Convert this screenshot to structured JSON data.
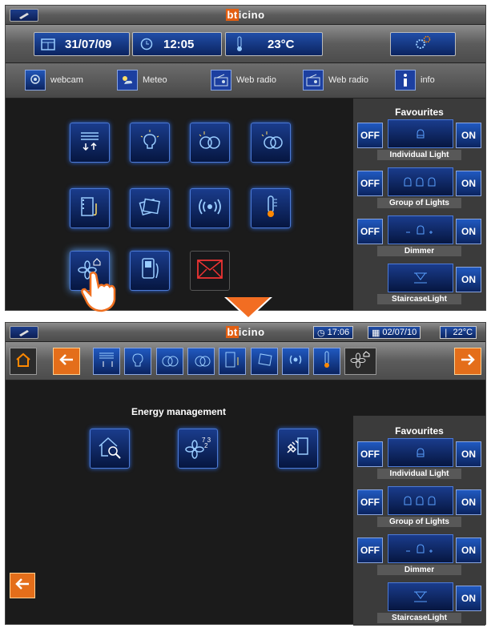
{
  "brand": {
    "prefix": "bt",
    "rest": "icino"
  },
  "screen1": {
    "date": "31/07/09",
    "time": "12:05",
    "temperature": "23°C",
    "menu": [
      {
        "icon": "webcam-icon",
        "label": "webcam"
      },
      {
        "icon": "meteo-icon",
        "label": "Meteo"
      },
      {
        "icon": "radio-icon",
        "label": "Web radio"
      },
      {
        "icon": "radio-icon",
        "label": "Web radio"
      },
      {
        "icon": "info-icon",
        "label": "info"
      }
    ]
  },
  "screen2": {
    "time": "17:06",
    "date": "02/07/10",
    "temperature": "22°C",
    "section_title": "Energy management"
  },
  "favourites": {
    "title": "Favourites",
    "off_label": "OFF",
    "on_label": "ON",
    "items": [
      {
        "label": "Individual Light"
      },
      {
        "label": "Group of Lights"
      },
      {
        "label": "Dimmer"
      },
      {
        "label": "StaircaseLight"
      }
    ]
  },
  "colors": {
    "accent": "#e46e1a",
    "blue": "#1c4ea8",
    "panel": "#3b3b3b",
    "background": "#1b1b1b"
  }
}
